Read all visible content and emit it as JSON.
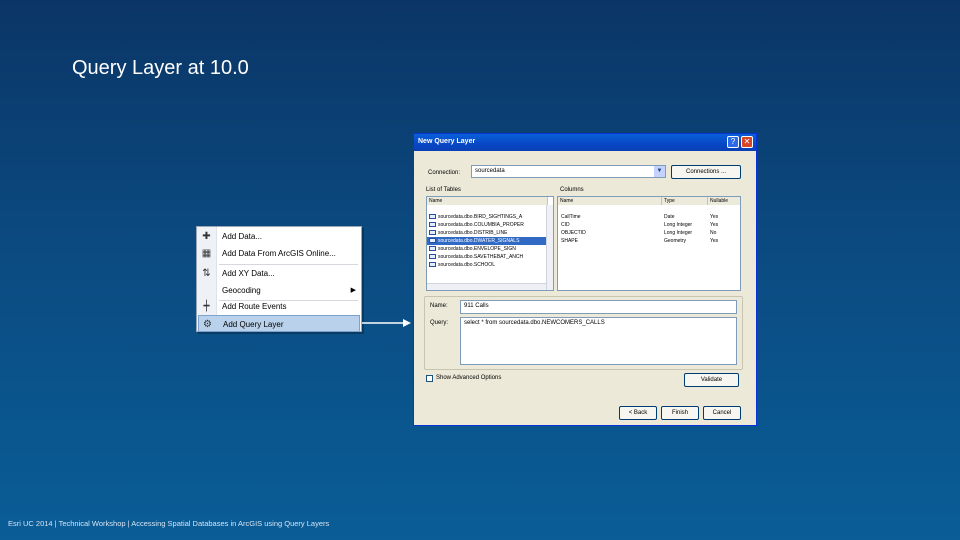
{
  "slide": {
    "title": "Query Layer at 10.0",
    "footer": "Esri UC 2014 | Technical Workshop | Accessing Spatial Databases in ArcGIS using Query Layers"
  },
  "context_menu": {
    "items": [
      {
        "label": "Add Data...",
        "icon": "add-data-icon",
        "glyph": "✚"
      },
      {
        "label": "Add Data From ArcGIS Online...",
        "icon": "arcgis-online-icon",
        "glyph": "▦"
      },
      {
        "label": "Add XY Data...",
        "icon": "xy-data-icon",
        "glyph": "⇅"
      },
      {
        "label": "Geocoding",
        "icon": "",
        "glyph": ""
      },
      {
        "label": "Add Route Events",
        "icon": "route-events-icon",
        "glyph": "┿"
      },
      {
        "label": "Add Query Layer",
        "icon": "query-layer-icon",
        "glyph": "⚙"
      }
    ],
    "submenu_arrow": "▶"
  },
  "dialog": {
    "title": "New Query Layer",
    "help": "?",
    "close": "✕",
    "connection_label": "Connection:",
    "connection_value": "sourcedata",
    "connections_button": "Connections ...",
    "list_of_tables_label": "List of Tables",
    "tables_header": "Name",
    "tables": [
      "sourcedata.dbo.BIRD_SIGHTINGS_A",
      "sourcedata.dbo.COLUMBIA_PROPER",
      "sourcedata.dbo.DISTRIB_LINE",
      "sourcedata.dbo.DWATER_SIGNALS",
      "sourcedata.dbo.ENVELOPE_SIGN",
      "sourcedata.dbo.SAVETHEBAT_ANCH",
      "sourcedata.dbo.SCHOOL"
    ],
    "selected_table_index": 3,
    "columns_label": "Columns",
    "columns_headers": [
      "Name",
      "Type",
      "Nullable"
    ],
    "columns": [
      [
        "CallTime",
        "Date",
        "Yes"
      ],
      [
        "CID",
        "Long Integer",
        "Yes"
      ],
      [
        "OBJECTID",
        "Long Integer",
        "No"
      ],
      [
        "SHAPE",
        "Geometry",
        "Yes"
      ]
    ],
    "name_label": "Name:",
    "name_value": "911 Calls",
    "query_label": "Query:",
    "query_value": "select * from sourcedata.dbo.NEWCOMERS_CALLS",
    "advanced_label": "Show Advanced Options",
    "validate_button": "Validate",
    "back_button": "< Back",
    "finish_button": "Finish",
    "cancel_button": "Cancel"
  },
  "colors": {
    "background_top": "#0b3566",
    "background_bottom": "#0a5d97",
    "titlebar": "#0a5fd8",
    "selection": "#316ac5",
    "menu_highlight": "#b9d1ea"
  }
}
